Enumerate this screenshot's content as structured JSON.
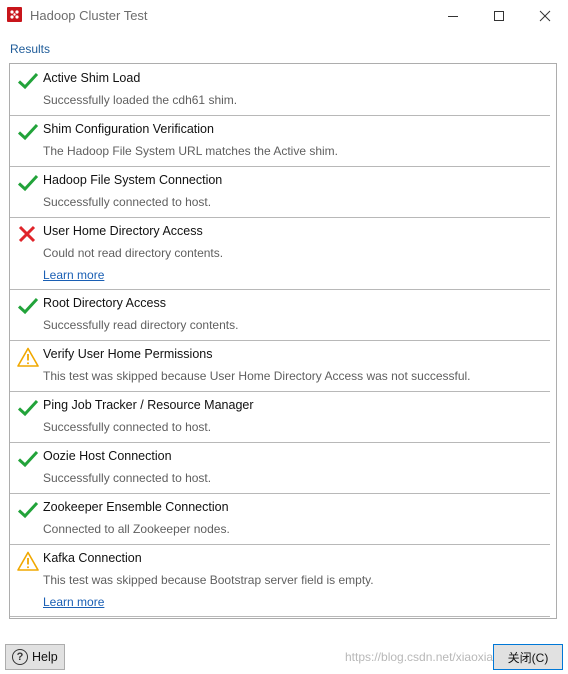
{
  "window": {
    "title": "Hadoop Cluster Test",
    "app_icon": "pentaho-app-icon",
    "controls": {
      "minimize": "minimize-icon",
      "maximize": "maximize-icon",
      "close": "close-icon"
    }
  },
  "results": {
    "label": "Results",
    "items": [
      {
        "status": "success",
        "title": "Active Shim Load",
        "detail": "Successfully loaded the cdh61 shim.",
        "link": ""
      },
      {
        "status": "success",
        "title": "Shim Configuration Verification",
        "detail": "The Hadoop File System URL matches the Active shim.",
        "link": ""
      },
      {
        "status": "success",
        "title": "Hadoop File System Connection",
        "detail": "Successfully connected to host.",
        "link": ""
      },
      {
        "status": "error",
        "title": "User Home Directory Access",
        "detail": "Could not read directory contents.",
        "link": "Learn more"
      },
      {
        "status": "success",
        "title": "Root Directory Access",
        "detail": "Successfully read directory contents.",
        "link": ""
      },
      {
        "status": "warning",
        "title": "Verify User Home Permissions",
        "detail": "This test was skipped because User Home Directory Access was not successful.",
        "link": ""
      },
      {
        "status": "success",
        "title": "Ping Job Tracker / Resource Manager",
        "detail": "Successfully connected to host.",
        "link": ""
      },
      {
        "status": "success",
        "title": "Oozie Host Connection",
        "detail": "Successfully connected to host.",
        "link": ""
      },
      {
        "status": "success",
        "title": "Zookeeper Ensemble Connection",
        "detail": "Connected to all Zookeeper nodes.",
        "link": ""
      },
      {
        "status": "warning",
        "title": "Kafka Connection",
        "detail": "This test was skipped because Bootstrap server field is empty.",
        "link": "Learn more"
      }
    ]
  },
  "footer": {
    "help_label": "Help",
    "close_label": "关闭(C)",
    "watermark": "https://blog.csdn.net/xiaoxiaojie"
  },
  "colors": {
    "success": "#22a33a",
    "error": "#e0242a",
    "warning": "#f0a800",
    "link": "#1a5fb4"
  }
}
